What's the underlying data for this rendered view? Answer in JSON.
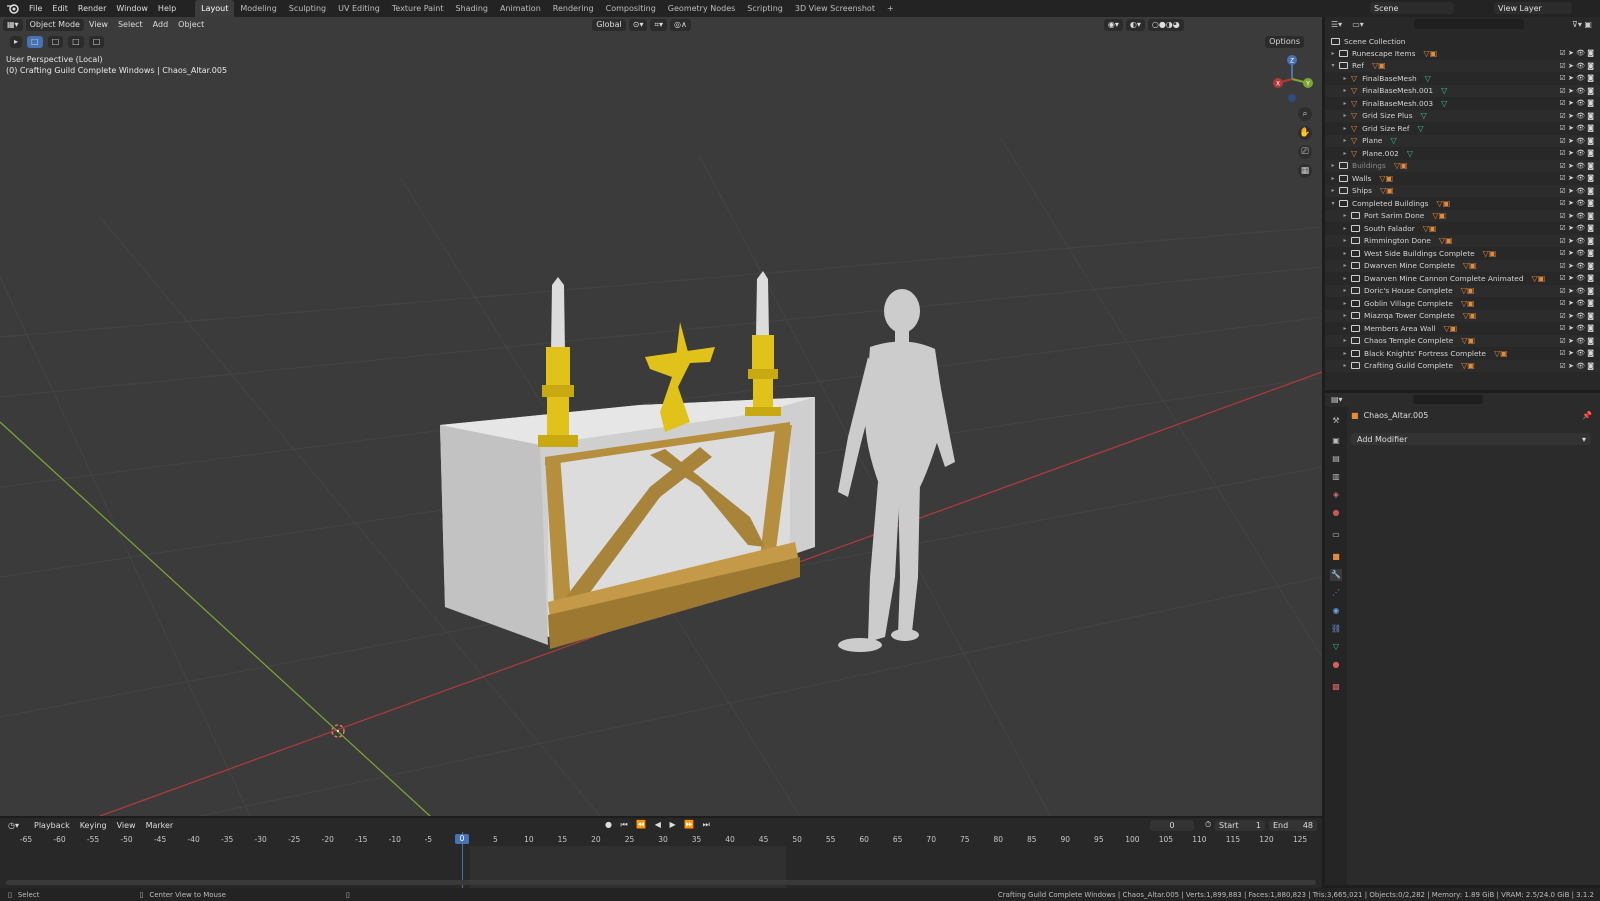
{
  "topbar": {
    "menus": [
      "File",
      "Edit",
      "Render",
      "Window",
      "Help"
    ],
    "workspaces": [
      "Layout",
      "Modeling",
      "Sculpting",
      "UV Editing",
      "Texture Paint",
      "Shading",
      "Animation",
      "Rendering",
      "Compositing",
      "Geometry Nodes",
      "Scripting",
      "3D View Screenshot"
    ],
    "active_workspace": "Layout",
    "add_workspace": "+",
    "scene": "Scene",
    "view_layer": "View Layer"
  },
  "viewport": {
    "mode": "Object Mode",
    "menus": [
      "View",
      "Select",
      "Add",
      "Object"
    ],
    "transform_orientation": "Global",
    "options": "Options",
    "perspective_label": "User Perspective (Local)",
    "object_label": "(0) Crafting Guild Complete Windows | Chaos_Altar.005",
    "gizmo_axes": [
      "Z",
      "Y",
      "X"
    ]
  },
  "outliner": {
    "root": "Scene Collection",
    "rows": [
      {
        "name": "Runescape Items",
        "type": "collection",
        "depth": 0,
        "expanded": false,
        "dim": false
      },
      {
        "name": "Ref",
        "type": "collection",
        "depth": 0,
        "expanded": true,
        "dim": false
      },
      {
        "name": "FinalBaseMesh",
        "type": "object",
        "depth": 1,
        "dim": false
      },
      {
        "name": "FinalBaseMesh.001",
        "type": "object",
        "depth": 1,
        "dim": false
      },
      {
        "name": "FinalBaseMesh.003",
        "type": "object",
        "depth": 1,
        "dim": false
      },
      {
        "name": "Grid Size Plus",
        "type": "object",
        "depth": 1,
        "dim": false
      },
      {
        "name": "Grid Size Ref",
        "type": "object",
        "depth": 1,
        "dim": false
      },
      {
        "name": "Plane",
        "type": "object",
        "depth": 1,
        "dim": false
      },
      {
        "name": "Plane.002",
        "type": "object",
        "depth": 1,
        "dim": false
      },
      {
        "name": "Buildings",
        "type": "collection",
        "depth": 0,
        "expanded": false,
        "dim": true
      },
      {
        "name": "Walls",
        "type": "collection",
        "depth": 0,
        "expanded": false,
        "dim": false
      },
      {
        "name": "Ships",
        "type": "collection",
        "depth": 0,
        "expanded": false,
        "dim": false
      },
      {
        "name": "Completed Buildings",
        "type": "collection",
        "depth": 0,
        "expanded": true,
        "dim": false
      },
      {
        "name": "Port Sarim Done",
        "type": "collection",
        "depth": 1,
        "dim": false
      },
      {
        "name": "South Falador",
        "type": "collection",
        "depth": 1,
        "dim": false
      },
      {
        "name": "Rimmington Done",
        "type": "collection",
        "depth": 1,
        "dim": false
      },
      {
        "name": "West Side Buildings Complete",
        "type": "collection",
        "depth": 1,
        "dim": false
      },
      {
        "name": "Dwarven Mine Complete",
        "type": "collection",
        "depth": 1,
        "dim": false
      },
      {
        "name": "Dwarven Mine Cannon Complete Animated",
        "type": "collection",
        "depth": 1,
        "dim": false
      },
      {
        "name": "Doric's House Complete",
        "type": "collection",
        "depth": 1,
        "dim": false
      },
      {
        "name": "Goblin Village Complete",
        "type": "collection",
        "depth": 1,
        "dim": false
      },
      {
        "name": "Miazrqa Tower Complete",
        "type": "collection",
        "depth": 1,
        "dim": false
      },
      {
        "name": "Members Area Wall",
        "type": "collection",
        "depth": 1,
        "dim": false
      },
      {
        "name": "Chaos Temple Complete",
        "type": "collection",
        "depth": 1,
        "dim": false
      },
      {
        "name": "Black Knights' Fortress Complete",
        "type": "collection",
        "depth": 1,
        "dim": false
      },
      {
        "name": "Crafting Guild Complete",
        "type": "collection",
        "depth": 1,
        "dim": false
      }
    ]
  },
  "properties": {
    "object_name": "Chaos_Altar.005",
    "add_modifier": "Add Modifier"
  },
  "timeline": {
    "menus": [
      "Playback",
      "Keying",
      "View",
      "Marker"
    ],
    "current_frame": "0",
    "start_label": "Start",
    "start_value": "1",
    "end_label": "End",
    "end_value": "48",
    "ruler": [
      "-65",
      "-60",
      "-55",
      "-50",
      "-45",
      "-40",
      "-35",
      "-30",
      "-25",
      "-20",
      "-15",
      "-10",
      "-5",
      "0",
      "5",
      "10",
      "15",
      "20",
      "25",
      "30",
      "35",
      "40",
      "45",
      "50",
      "55",
      "60",
      "65",
      "70",
      "75",
      "80",
      "85",
      "90",
      "95",
      "100",
      "105",
      "110",
      "115",
      "120",
      "125"
    ]
  },
  "status": {
    "left_action": "Select",
    "middle_action": "Center View to Mouse",
    "stats": "Crafting Guild Complete Windows | Chaos_Altar.005 | Verts:1,899,883 | Faces:1,880,823 | Tris:3,665,021 | Objects:0/2,282 | Memory: 1.89 GiB | VRAM: 2.5/24.0 GiB | 3.1.2"
  },
  "colors": {
    "viewport_bg": "#3b3b3b",
    "altar_cloth": "#d9d9d9",
    "altar_wood": "#b58e3e",
    "candle_gold": "#e0c21a",
    "figure": "#cfcfcf",
    "axis_x": "#b33a3a",
    "axis_y": "#7ea833",
    "accent": "#4772b3"
  }
}
